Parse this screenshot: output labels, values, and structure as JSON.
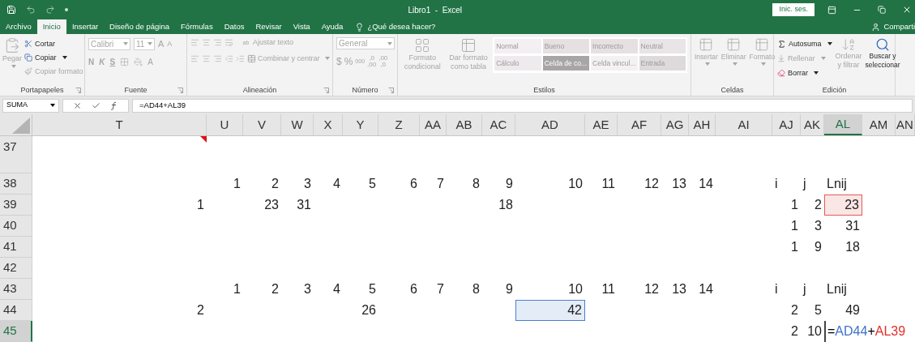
{
  "window": {
    "title": "Libro1  -  Excel",
    "signin": "Inic. ses."
  },
  "tabs": [
    {
      "label": "Archivo",
      "selected": false
    },
    {
      "label": "Inicio",
      "selected": true
    },
    {
      "label": "Insertar",
      "selected": false
    },
    {
      "label": "Diseño de página",
      "selected": false
    },
    {
      "label": "Fórmulas",
      "selected": false
    },
    {
      "label": "Datos",
      "selected": false
    },
    {
      "label": "Revisar",
      "selected": false
    },
    {
      "label": "Vista",
      "selected": false
    },
    {
      "label": "Ayuda",
      "selected": false
    }
  ],
  "tell_me": {
    "placeholder": "¿Qué desea hacer?"
  },
  "share": "Comparti",
  "ribbon": {
    "clipboard": {
      "label": "Portapapeles",
      "paste": {
        "label": "Pegar",
        "disabled": true
      },
      "cut": {
        "label": "Cortar",
        "disabled": false
      },
      "copy": {
        "label": "Copiar",
        "disabled": false
      },
      "format_painter": {
        "label": "Copiar formato",
        "disabled": true
      }
    },
    "font": {
      "label": "Fuente",
      "font_name": "Calibri",
      "font_size": "11",
      "grow": "A",
      "shrink": "A",
      "bold": "N",
      "italic": "K",
      "underline": "S",
      "font_color": "A"
    },
    "alignment": {
      "label": "Alineación",
      "wrap_text": "Ajustar texto",
      "wrap_icon": "ab",
      "merge": "Combinar y centrar"
    },
    "number": {
      "label": "Número",
      "format": "General",
      "currency": "$",
      "percent": "%",
      "thousands": "000",
      "inc_decimal": [
        ",0",
        ",00"
      ],
      "dec_decimal": [
        ",00",
        ",0"
      ]
    },
    "styles": {
      "label": "Estilos",
      "conditional": "Formato condicional",
      "as_table": "Dar formato como tabla",
      "gallery": [
        {
          "label": "Normal",
          "color": "#f4eff2"
        },
        {
          "label": "Bueno",
          "color": "#e6e0e3"
        },
        {
          "label": "Incorrecto",
          "color": "#e6e0e3"
        },
        {
          "label": "Neutral",
          "color": "#e9e4e7"
        },
        {
          "label": "Cálculo",
          "color": "#efeaed"
        },
        {
          "label": "Celda de co...",
          "color": "#a8a5a7"
        },
        {
          "label": "Celda vincul...",
          "color": "#f4f1f3"
        },
        {
          "label": "Entrada",
          "color": "#dedadc"
        }
      ]
    },
    "cells": {
      "label": "Celdas",
      "items": [
        {
          "label": "Insertar",
          "disabled": true
        },
        {
          "label": "Eliminar",
          "disabled": true
        },
        {
          "label": "Formato",
          "disabled": true
        }
      ]
    },
    "editing": {
      "label": "Edición",
      "autosum": {
        "label": "Autosuma",
        "disabled": false
      },
      "fill": {
        "label": "Rellenar",
        "disabled": true
      },
      "clear": {
        "label": "Borrar",
        "disabled": false
      },
      "sort": {
        "label": "Ordenar y filtrar",
        "disabled": true
      },
      "find": {
        "label": "Buscar y seleccionar",
        "disabled": false
      }
    }
  },
  "formula_bar": {
    "name_box": "SUMA",
    "formula": "=AD44+AL39"
  },
  "columns": [
    {
      "label": "T",
      "selected": false
    },
    {
      "label": "U",
      "selected": false
    },
    {
      "label": "V",
      "selected": false
    },
    {
      "label": "W",
      "selected": false
    },
    {
      "label": "X",
      "selected": false
    },
    {
      "label": "Y",
      "selected": false
    },
    {
      "label": "Z",
      "selected": false
    },
    {
      "label": "AA",
      "selected": false
    },
    {
      "label": "AB",
      "selected": false
    },
    {
      "label": "AC",
      "selected": false
    },
    {
      "label": "AD",
      "selected": false
    },
    {
      "label": "AE",
      "selected": false
    },
    {
      "label": "AF",
      "selected": false
    },
    {
      "label": "AG",
      "selected": false
    },
    {
      "label": "AH",
      "selected": false
    },
    {
      "label": "AI",
      "selected": false
    },
    {
      "label": "AJ",
      "selected": false
    },
    {
      "label": "AK",
      "selected": false
    },
    {
      "label": "AL",
      "selected": true
    },
    {
      "label": "AM",
      "selected": false
    },
    {
      "label": "AN",
      "selected": false
    }
  ],
  "rows": [
    {
      "label": "37",
      "selected": false,
      "cells": [
        {
          "kind": "empty",
          "comment": true
        },
        null,
        null,
        null,
        null,
        null,
        null,
        null,
        null,
        null,
        null,
        null,
        null,
        null,
        null,
        null,
        null,
        null,
        null,
        null,
        null
      ]
    },
    {
      "label": "38",
      "selected": false,
      "cells": [
        null,
        {
          "kind": "number",
          "text": "1"
        },
        {
          "kind": "number",
          "text": "2"
        },
        {
          "kind": "number",
          "text": "3"
        },
        {
          "kind": "number",
          "text": "4"
        },
        {
          "kind": "number",
          "text": "5"
        },
        {
          "kind": "number",
          "text": "6"
        },
        {
          "kind": "number",
          "text": "7"
        },
        {
          "kind": "number",
          "text": "8"
        },
        {
          "kind": "number",
          "text": "9"
        },
        {
          "kind": "number",
          "text": "10"
        },
        {
          "kind": "number",
          "text": "11"
        },
        {
          "kind": "number",
          "text": "12"
        },
        {
          "kind": "number",
          "text": "13"
        },
        {
          "kind": "number",
          "text": "14"
        },
        null,
        {
          "kind": "text",
          "text": "i"
        },
        {
          "kind": "text",
          "text": "j"
        },
        {
          "kind": "text",
          "text": "Lnij"
        },
        null,
        null
      ]
    },
    {
      "label": "39",
      "selected": false,
      "cells": [
        {
          "kind": "number",
          "text": "1"
        },
        null,
        {
          "kind": "number",
          "text": "23"
        },
        {
          "kind": "number",
          "text": "31"
        },
        null,
        null,
        null,
        null,
        null,
        {
          "kind": "number",
          "text": "18"
        },
        null,
        null,
        null,
        null,
        null,
        null,
        {
          "kind": "number",
          "text": "1"
        },
        {
          "kind": "number",
          "text": "2"
        },
        {
          "kind": "number",
          "text": "23",
          "color": "#e35a5a"
        },
        null,
        null
      ]
    },
    {
      "label": "40",
      "selected": false,
      "cells": [
        null,
        null,
        null,
        null,
        null,
        null,
        null,
        null,
        null,
        null,
        null,
        null,
        null,
        null,
        null,
        null,
        {
          "kind": "number",
          "text": "1"
        },
        {
          "kind": "number",
          "text": "3"
        },
        {
          "kind": "number",
          "text": "31"
        },
        null,
        null
      ]
    },
    {
      "label": "41",
      "selected": false,
      "cells": [
        null,
        null,
        null,
        null,
        null,
        null,
        null,
        null,
        null,
        null,
        null,
        null,
        null,
        null,
        null,
        null,
        {
          "kind": "number",
          "text": "1"
        },
        {
          "kind": "number",
          "text": "9"
        },
        {
          "kind": "number",
          "text": "18"
        },
        null,
        null
      ]
    },
    {
      "label": "42",
      "selected": false,
      "cells": [
        null,
        null,
        null,
        null,
        null,
        null,
        null,
        null,
        null,
        null,
        null,
        null,
        null,
        null,
        null,
        null,
        null,
        null,
        null,
        null,
        null
      ]
    },
    {
      "label": "43",
      "selected": false,
      "cells": [
        null,
        {
          "kind": "number",
          "text": "1"
        },
        {
          "kind": "number",
          "text": "2"
        },
        {
          "kind": "number",
          "text": "3"
        },
        {
          "kind": "number",
          "text": "4"
        },
        {
          "kind": "number",
          "text": "5"
        },
        {
          "kind": "number",
          "text": "6"
        },
        {
          "kind": "number",
          "text": "7"
        },
        {
          "kind": "number",
          "text": "8"
        },
        {
          "kind": "number",
          "text": "9"
        },
        {
          "kind": "number",
          "text": "10"
        },
        {
          "kind": "number",
          "text": "11"
        },
        {
          "kind": "number",
          "text": "12"
        },
        {
          "kind": "number",
          "text": "13"
        },
        {
          "kind": "number",
          "text": "14"
        },
        null,
        {
          "kind": "text",
          "text": "i"
        },
        {
          "kind": "text",
          "text": "j"
        },
        {
          "kind": "text",
          "text": "Lnij"
        },
        null,
        null
      ]
    },
    {
      "label": "44",
      "selected": false,
      "cells": [
        {
          "kind": "number",
          "text": "2"
        },
        null,
        null,
        null,
        null,
        {
          "kind": "number",
          "text": "26"
        },
        null,
        null,
        null,
        null,
        {
          "kind": "number",
          "text": "42",
          "color": "#4a7fd0"
        },
        null,
        null,
        null,
        null,
        null,
        {
          "kind": "number",
          "text": "2"
        },
        {
          "kind": "number",
          "text": "5"
        },
        {
          "kind": "number",
          "text": "49"
        },
        null,
        null
      ]
    },
    {
      "label": "45",
      "selected": true,
      "cells": [
        null,
        null,
        null,
        null,
        null,
        null,
        null,
        null,
        null,
        null,
        null,
        null,
        null,
        null,
        null,
        null,
        {
          "kind": "number",
          "text": "2"
        },
        {
          "kind": "number",
          "text": "10"
        },
        {
          "kind": "formula",
          "active": true,
          "parts": [
            {
              "text": "=",
              "color": "#000000"
            },
            {
              "text": "AD44",
              "color": "#3f72c8"
            },
            {
              "text": "+",
              "color": "#000000"
            },
            {
              "text": "AL39",
              "color": "#e0302c"
            }
          ]
        },
        null,
        null
      ]
    }
  ]
}
